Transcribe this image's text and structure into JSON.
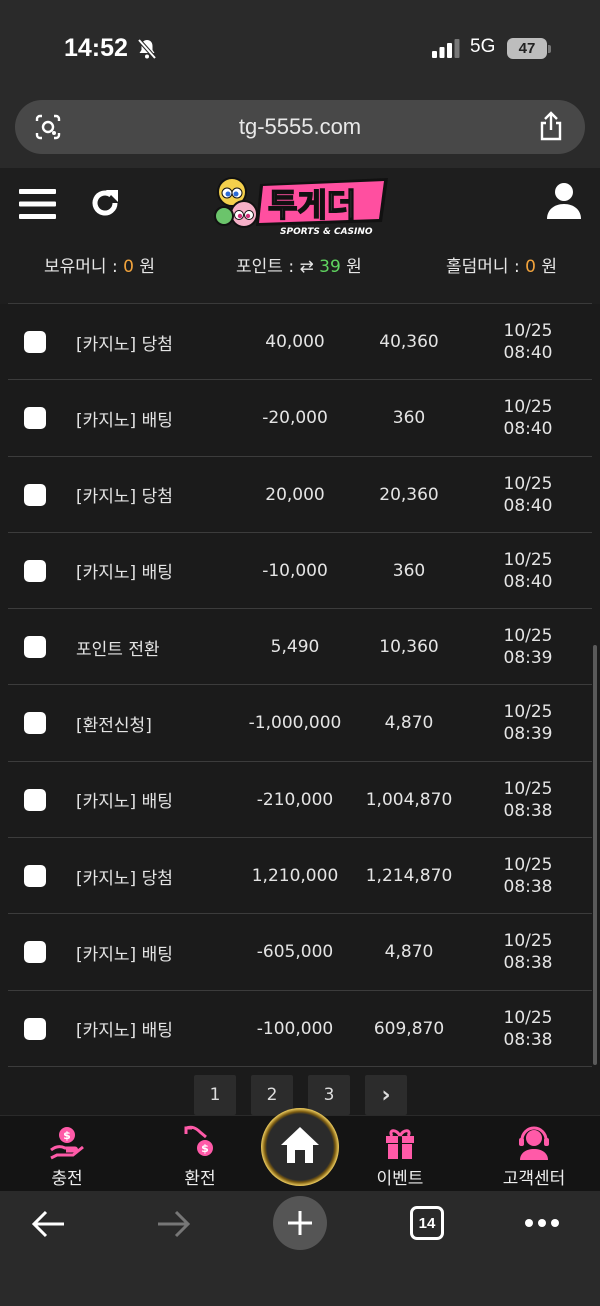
{
  "status_bar": {
    "time": "14:52",
    "network": "5G",
    "battery": "47"
  },
  "browser": {
    "url": "tg-5555.com",
    "tab_count": "14"
  },
  "site": {
    "logo_text": "투게더",
    "logo_sub": "SPORTS & CASINO"
  },
  "balances": {
    "money_label": "보유머니 : ",
    "money_value": "0",
    "money_unit": " 원",
    "point_label": "포인트 : ",
    "point_value": "39",
    "point_unit": " 원",
    "holdem_label": "홀덤머니 : ",
    "holdem_value": "0",
    "holdem_unit": " 원"
  },
  "rows": [
    {
      "type": "[카지노] 당첨",
      "amount": "40,000",
      "balance": "40,360",
      "date": "10/25",
      "time": "08:40"
    },
    {
      "type": "[카지노] 배팅",
      "amount": "-20,000",
      "balance": "360",
      "date": "10/25",
      "time": "08:40"
    },
    {
      "type": "[카지노] 당첨",
      "amount": "20,000",
      "balance": "20,360",
      "date": "10/25",
      "time": "08:40"
    },
    {
      "type": "[카지노] 배팅",
      "amount": "-10,000",
      "balance": "360",
      "date": "10/25",
      "time": "08:40"
    },
    {
      "type": "포인트 전환",
      "amount": "5,490",
      "balance": "10,360",
      "date": "10/25",
      "time": "08:39"
    },
    {
      "type": "[환전신청]",
      "amount": "-1,000,000",
      "balance": "4,870",
      "date": "10/25",
      "time": "08:39"
    },
    {
      "type": "[카지노] 배팅",
      "amount": "-210,000",
      "balance": "1,004,870",
      "date": "10/25",
      "time": "08:38"
    },
    {
      "type": "[카지노] 당첨",
      "amount": "1,210,000",
      "balance": "1,214,870",
      "date": "10/25",
      "time": "08:38"
    },
    {
      "type": "[카지노] 배팅",
      "amount": "-605,000",
      "balance": "4,870",
      "date": "10/25",
      "time": "08:38"
    },
    {
      "type": "[카지노] 배팅",
      "amount": "-100,000",
      "balance": "609,870",
      "date": "10/25",
      "time": "08:38"
    }
  ],
  "pagination": {
    "pages": [
      "1",
      "2",
      "3"
    ],
    "next": "›"
  },
  "bottom_nav": {
    "charge": "충전",
    "exchange": "환전",
    "event": "이벤트",
    "support": "고객센터"
  },
  "colors": {
    "accent_orange": "#f0a23c",
    "accent_green": "#5fd35f",
    "nav_pink": "#ff5aa8"
  }
}
